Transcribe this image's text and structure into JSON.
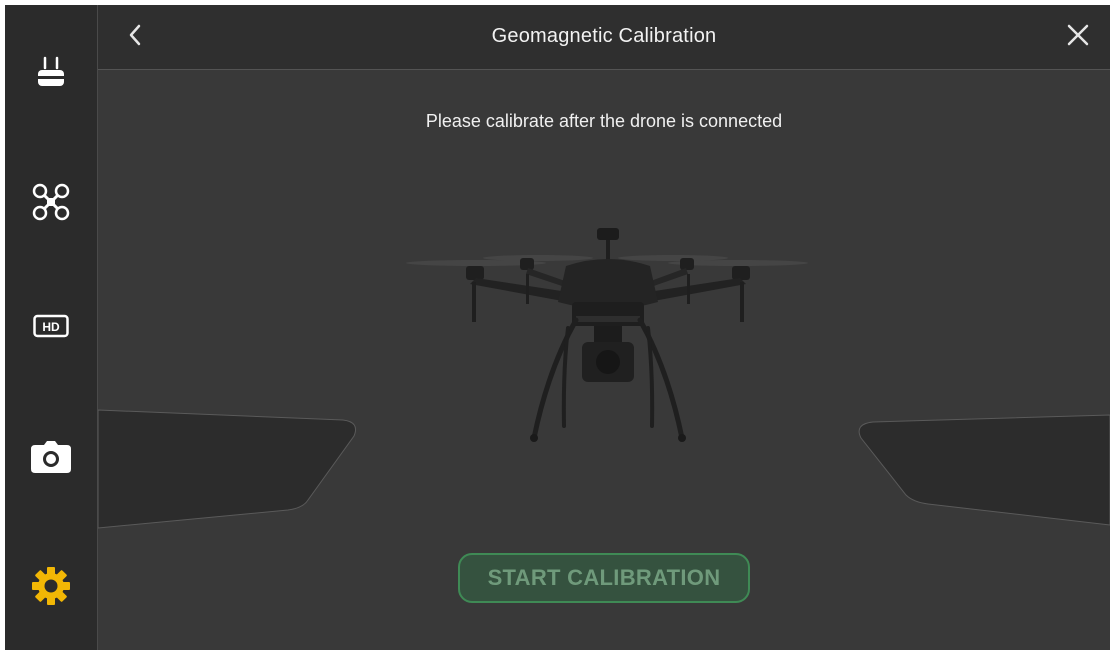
{
  "header": {
    "title": "Geomagnetic Calibration",
    "back_icon": "chevron-left-icon",
    "close_icon": "close-icon"
  },
  "sidebar": {
    "items": [
      {
        "icon": "remote-controller-icon",
        "active": false
      },
      {
        "icon": "drone-icon",
        "active": false
      },
      {
        "icon": "hd-icon",
        "active": false
      },
      {
        "icon": "camera-icon",
        "active": false
      },
      {
        "icon": "gear-icon",
        "active": true
      }
    ]
  },
  "main": {
    "message": "Please calibrate after the drone is connected",
    "start_button_label": "START CALIBRATION"
  },
  "colors": {
    "accent": "#f2b705",
    "button_border": "#3f8a55",
    "button_bg": "#35523f",
    "button_text": "#6f9a7b",
    "sidebar_bg": "#2b2b2b",
    "content_bg": "#393939"
  }
}
